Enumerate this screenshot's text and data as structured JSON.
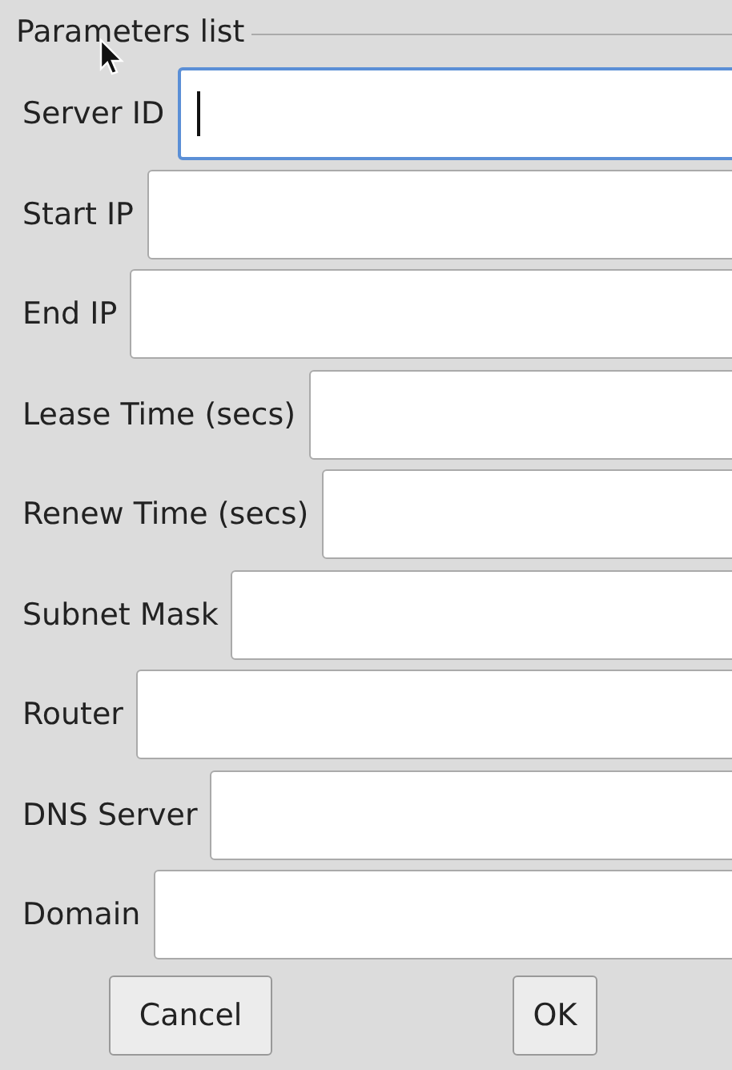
{
  "group": {
    "title": "Parameters list"
  },
  "fields": [
    {
      "label": "Server ID",
      "focused": true
    },
    {
      "label": "Start IP",
      "focused": false
    },
    {
      "label": "End IP",
      "focused": false
    },
    {
      "label": "Lease Time (secs)",
      "focused": false
    },
    {
      "label": "Renew Time (secs)",
      "focused": false
    },
    {
      "label": "Subnet Mask",
      "focused": false
    },
    {
      "label": "Router",
      "focused": false
    },
    {
      "label": "DNS Server",
      "focused": false
    },
    {
      "label": "Domain",
      "focused": false
    }
  ],
  "buttons": [
    "Cancel",
    "OK"
  ]
}
